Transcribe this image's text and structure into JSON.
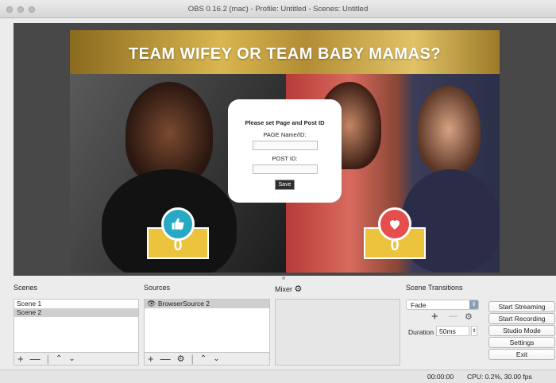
{
  "window": {
    "title": "OBS 0.16.2 (mac) - Profile: Untitled - Scenes: Untitled"
  },
  "stage": {
    "banner": "TEAM WIFEY OR TEAM BABY MAMAS?",
    "left_count": "0",
    "right_count": "0",
    "left_icon": "thumbs-up-icon",
    "right_icon": "heart-icon",
    "colors": {
      "vote_box": "#ECC33C",
      "like_circle": "#27A9C4",
      "heart_circle": "#E64D4D"
    }
  },
  "modal": {
    "title": "Please set Page and Post ID",
    "page_label": "PAGE Name/ID:",
    "post_label": "POST ID:",
    "save": "Save"
  },
  "scenes": {
    "title": "Scenes",
    "items": [
      "Scene 1",
      "Scene 2"
    ],
    "selected": 1
  },
  "sources": {
    "title": "Sources",
    "items": [
      "BrowserSource 2"
    ]
  },
  "mixer": {
    "title": "Mixer"
  },
  "transitions": {
    "title": "Scene Transitions",
    "selected": "Fade",
    "duration_label": "Duration",
    "duration_value": "50ms"
  },
  "controls": {
    "start_streaming": "Start Streaming",
    "start_recording": "Start Recording",
    "studio_mode": "Studio Mode",
    "settings": "Settings",
    "exit": "Exit"
  },
  "status": {
    "time": "00:00:00",
    "cpu": "CPU: 0.2%, 30.00 fps"
  }
}
